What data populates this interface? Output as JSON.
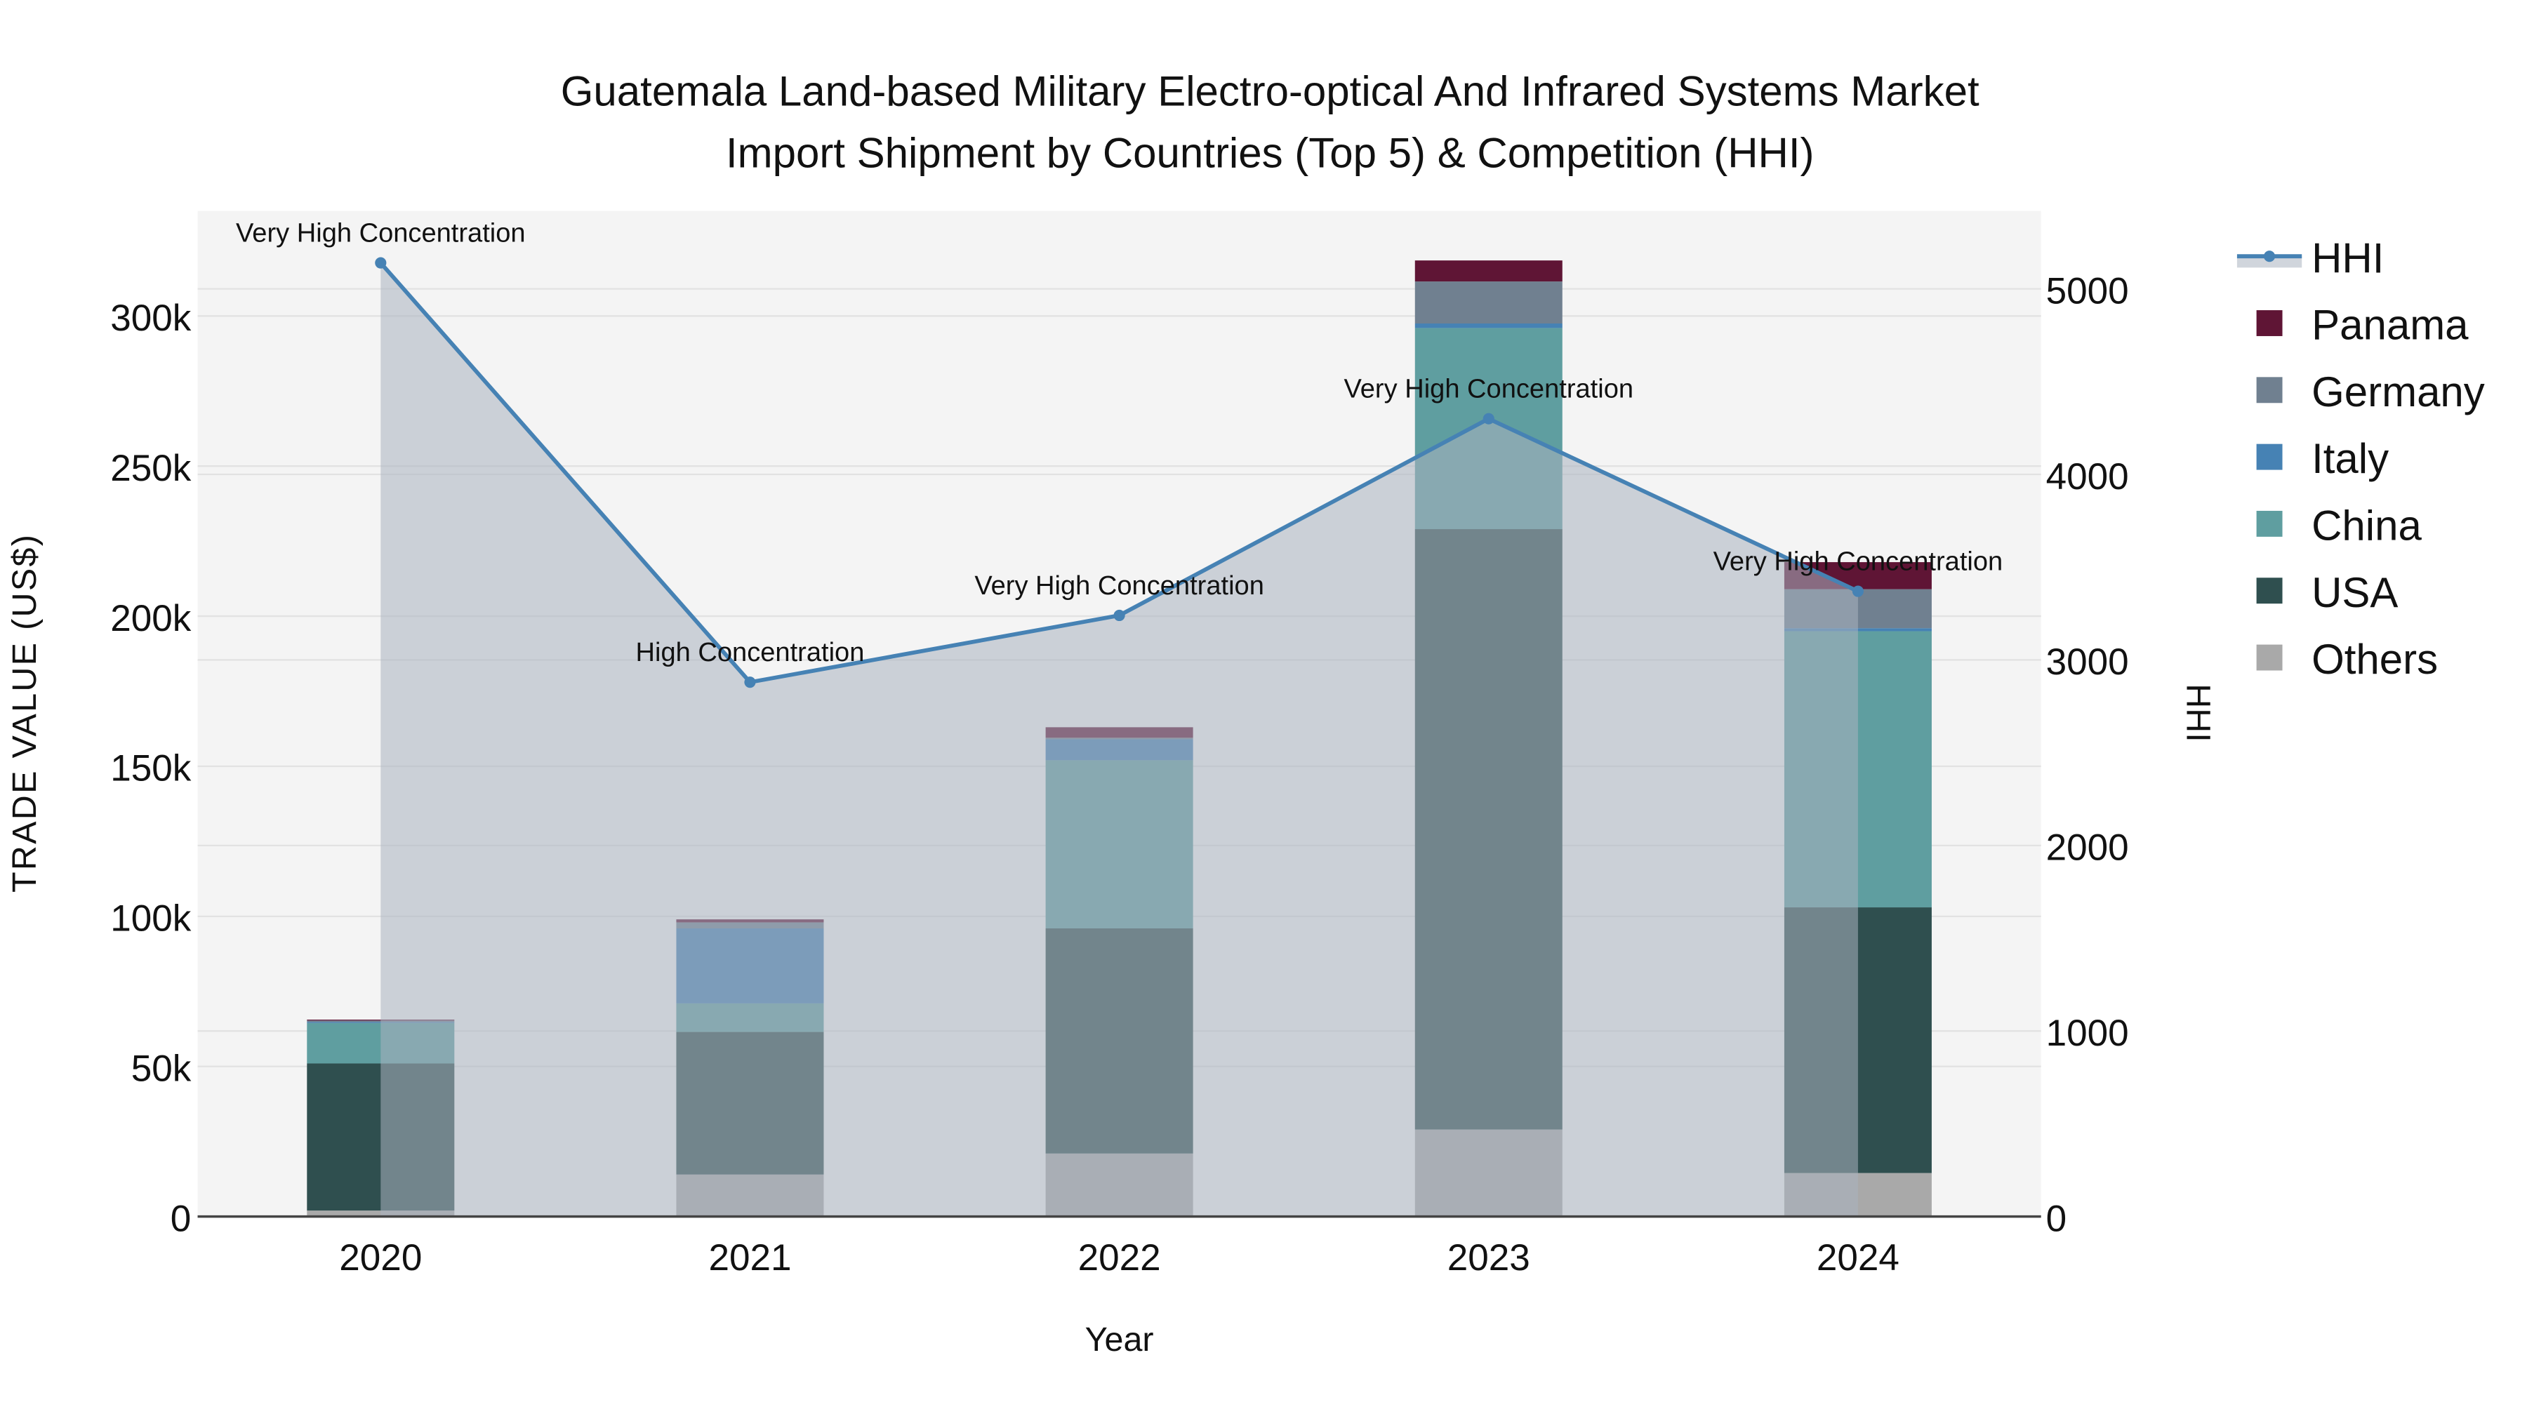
{
  "chart_data": {
    "type": "bar",
    "title_line1": "Guatemala Land-based Military Electro-optical And Infrared Systems Market",
    "title_line2": "Import Shipment by Countries (Top 5) & Competition (HHI)",
    "xlabel": "Year",
    "ylabel": "TRADE VALUE (US$)",
    "y2label": "HHI",
    "categories": [
      "2020",
      "2021",
      "2022",
      "2023",
      "2024"
    ],
    "ylim": [
      0,
      335000
    ],
    "y2lim": [
      0,
      5420
    ],
    "yticks": [
      0,
      50000,
      100000,
      150000,
      200000,
      250000,
      300000
    ],
    "ytick_labels": [
      "0",
      "50k",
      "100k",
      "150k",
      "200k",
      "250k",
      "300k"
    ],
    "y2ticks": [
      0,
      1000,
      2000,
      3000,
      4000,
      5000
    ],
    "y2tick_labels": [
      "0",
      "1000",
      "2000",
      "3000",
      "4000",
      "5000"
    ],
    "series": [
      {
        "name": "Others",
        "color": "#a9a9a9",
        "values": [
          2000,
          14000,
          21000,
          29000,
          14500
        ]
      },
      {
        "name": "USA",
        "color": "#2f4f4f",
        "values": [
          49000,
          47500,
          75000,
          200000,
          88500
        ]
      },
      {
        "name": "China",
        "color": "#5f9ea0",
        "values": [
          13500,
          9500,
          56000,
          67000,
          92000
        ]
      },
      {
        "name": "Italy",
        "color": "#4682b4",
        "values": [
          300,
          25000,
          7000,
          1500,
          1000
        ]
      },
      {
        "name": "Germany",
        "color": "#708090",
        "values": [
          500,
          2000,
          500,
          14000,
          13000
        ]
      },
      {
        "name": "Panama",
        "color": "#5f1535",
        "values": [
          300,
          1000,
          3500,
          7000,
          9000
        ]
      }
    ],
    "hhi": {
      "name": "HHI",
      "color": "#4682b4",
      "values": [
        5140,
        2880,
        3240,
        4300,
        3370
      ],
      "annotations": [
        "Very High Concentration",
        "High Concentration",
        "Very High Concentration",
        "Very High Concentration",
        "Very High Concentration"
      ]
    },
    "legend_order": [
      "HHI",
      "Panama",
      "Germany",
      "Italy",
      "China",
      "USA",
      "Others"
    ],
    "legend_placement": "right",
    "grid": true
  }
}
